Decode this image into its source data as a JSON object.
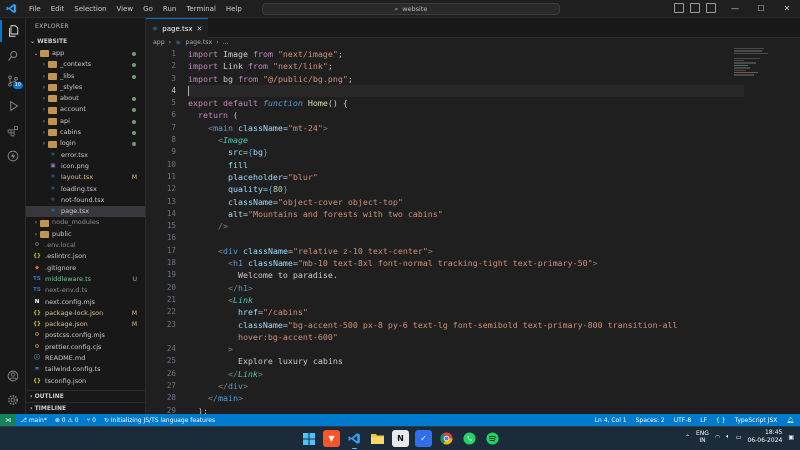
{
  "titlebar": {
    "menu": [
      "File",
      "Edit",
      "Selection",
      "View",
      "Go",
      "Run",
      "Terminal",
      "Help"
    ],
    "search_text": "website"
  },
  "sidebar": {
    "title": "EXPLORER",
    "root": "WEBSITE",
    "items": [
      {
        "label": "app",
        "type": "folder",
        "open": true,
        "indent": 0,
        "status": "dot",
        "cls": "lbl"
      },
      {
        "label": "_contexts",
        "type": "folder",
        "indent": 1,
        "status": "dot",
        "cls": "lbl"
      },
      {
        "label": "_libs",
        "type": "folder",
        "indent": 1,
        "status": "dot",
        "cls": "lbl"
      },
      {
        "label": "_styles",
        "type": "folder",
        "indent": 1,
        "status": "",
        "cls": "lbl"
      },
      {
        "label": "about",
        "type": "folder",
        "indent": 1,
        "status": "dot",
        "cls": "lbl"
      },
      {
        "label": "account",
        "type": "folder",
        "indent": 1,
        "status": "dot",
        "cls": "lbl"
      },
      {
        "label": "api",
        "type": "folder",
        "indent": 1,
        "status": "dot",
        "cls": "lbl"
      },
      {
        "label": "cabins",
        "type": "folder",
        "indent": 1,
        "status": "dot",
        "cls": "lbl"
      },
      {
        "label": "login",
        "type": "folder",
        "indent": 1,
        "status": "dot",
        "cls": "lbl"
      },
      {
        "label": "error.tsx",
        "type": "tsx",
        "indent": 2,
        "status": "",
        "cls": "lbl"
      },
      {
        "label": "icon.png",
        "type": "img",
        "indent": 2,
        "status": "",
        "cls": "lbl"
      },
      {
        "label": "layout.tsx",
        "type": "tsx",
        "indent": 2,
        "status": "M",
        "cls": "lbl mod"
      },
      {
        "label": "loading.tsx",
        "type": "tsx",
        "indent": 2,
        "status": "",
        "cls": "lbl"
      },
      {
        "label": "not-found.tsx",
        "type": "tsx",
        "indent": 2,
        "status": "",
        "cls": "lbl"
      },
      {
        "label": "page.tsx",
        "type": "tsx",
        "indent": 2,
        "status": "",
        "cls": "lbl",
        "selected": true
      },
      {
        "label": "node_modules",
        "type": "folder",
        "indent": 0,
        "status": "",
        "cls": "lbl dim"
      },
      {
        "label": "public",
        "type": "folder",
        "indent": 0,
        "status": "",
        "cls": "lbl"
      },
      {
        "label": ".env.local",
        "type": "env",
        "indent": 0,
        "status": "",
        "cls": "lbl dim"
      },
      {
        "label": ".eslintrc.json",
        "type": "json",
        "indent": 0,
        "status": "",
        "cls": "lbl"
      },
      {
        "label": ".gitignore",
        "type": "git",
        "indent": 0,
        "status": "",
        "cls": "lbl"
      },
      {
        "label": "middleware.ts",
        "type": "ts",
        "indent": 0,
        "status": "U",
        "cls": "lbl untr"
      },
      {
        "label": "next-env.d.ts",
        "type": "ts",
        "indent": 0,
        "status": "",
        "cls": "lbl dim"
      },
      {
        "label": "next.config.mjs",
        "type": "next",
        "indent": 0,
        "status": "",
        "cls": "lbl"
      },
      {
        "label": "package-lock.json",
        "type": "json",
        "indent": 0,
        "status": "M",
        "cls": "lbl mod"
      },
      {
        "label": "package.json",
        "type": "json",
        "indent": 0,
        "status": "M",
        "cls": "lbl mod"
      },
      {
        "label": "postcss.config.mjs",
        "type": "js",
        "indent": 0,
        "status": "",
        "cls": "lbl"
      },
      {
        "label": "prettier.config.cjs",
        "type": "js",
        "indent": 0,
        "status": "",
        "cls": "lbl"
      },
      {
        "label": "README.md",
        "type": "md",
        "indent": 0,
        "status": "",
        "cls": "lbl"
      },
      {
        "label": "tailwind.config.ts",
        "type": "tw",
        "indent": 0,
        "status": "",
        "cls": "lbl"
      },
      {
        "label": "tsconfig.json",
        "type": "json",
        "indent": 0,
        "status": "",
        "cls": "lbl"
      }
    ],
    "outline": "OUTLINE",
    "timeline": "TIMELINE"
  },
  "editor": {
    "tab": "page.tsx",
    "breadcrumb": [
      "app",
      "page.tsx",
      "..."
    ],
    "lines": [
      [
        [
          "kw",
          "import"
        ],
        [
          "txt",
          " Image "
        ],
        [
          "kw",
          "from"
        ],
        [
          "txt",
          " "
        ],
        [
          "str",
          "\"next/image\""
        ],
        [
          "txt",
          ";"
        ]
      ],
      [
        [
          "kw",
          "import"
        ],
        [
          "txt",
          " Link "
        ],
        [
          "kw",
          "from"
        ],
        [
          "txt",
          " "
        ],
        [
          "str",
          "\"next/link\""
        ],
        [
          "txt",
          ";"
        ]
      ],
      [
        [
          "kw",
          "import"
        ],
        [
          "txt",
          " bg "
        ],
        [
          "kw",
          "from"
        ],
        [
          "txt",
          " "
        ],
        [
          "str",
          "\"@/public/bg.png\""
        ],
        [
          "txt",
          ";"
        ]
      ],
      [],
      [
        [
          "kw",
          "export"
        ],
        [
          "txt",
          " "
        ],
        [
          "kw",
          "default"
        ],
        [
          "txt",
          " "
        ],
        [
          "kw2 it",
          "function"
        ],
        [
          "txt",
          " "
        ],
        [
          "fn",
          "Home"
        ],
        [
          "txt",
          "() {"
        ]
      ],
      [
        [
          "txt",
          "  "
        ],
        [
          "kw",
          "return"
        ],
        [
          "txt",
          " ("
        ]
      ],
      [
        [
          "txt",
          "    "
        ],
        [
          "punc",
          "<"
        ],
        [
          "tag",
          "main"
        ],
        [
          "txt",
          " "
        ],
        [
          "attr",
          "className"
        ],
        [
          "txt",
          "="
        ],
        [
          "str",
          "\"mt-24\""
        ],
        [
          "punc",
          ">"
        ]
      ],
      [
        [
          "txt",
          "      "
        ],
        [
          "punc",
          "<"
        ],
        [
          "comp it",
          "Image"
        ]
      ],
      [
        [
          "txt",
          "        "
        ],
        [
          "attr",
          "src"
        ],
        [
          "txt",
          "="
        ],
        [
          "brace",
          "{"
        ],
        [
          "var",
          "bg"
        ],
        [
          "brace",
          "}"
        ]
      ],
      [
        [
          "txt",
          "        "
        ],
        [
          "attr",
          "fill"
        ]
      ],
      [
        [
          "txt",
          "        "
        ],
        [
          "attr",
          "placeholder"
        ],
        [
          "txt",
          "="
        ],
        [
          "str",
          "\"blur\""
        ]
      ],
      [
        [
          "txt",
          "        "
        ],
        [
          "attr",
          "quality"
        ],
        [
          "txt",
          "="
        ],
        [
          "brace",
          "{"
        ],
        [
          "num",
          "80"
        ],
        [
          "brace",
          "}"
        ]
      ],
      [
        [
          "txt",
          "        "
        ],
        [
          "attr",
          "className"
        ],
        [
          "txt",
          "="
        ],
        [
          "str",
          "\"object-cover object-top\""
        ]
      ],
      [
        [
          "txt",
          "        "
        ],
        [
          "attr",
          "alt"
        ],
        [
          "txt",
          "="
        ],
        [
          "str",
          "\"Mountains and forests with two cabins\""
        ]
      ],
      [
        [
          "txt",
          "      "
        ],
        [
          "punc",
          "/>"
        ]
      ],
      [],
      [
        [
          "txt",
          "      "
        ],
        [
          "punc",
          "<"
        ],
        [
          "tag",
          "div"
        ],
        [
          "txt",
          " "
        ],
        [
          "attr",
          "className"
        ],
        [
          "txt",
          "="
        ],
        [
          "str",
          "\"relative z-10 text-center\""
        ],
        [
          "punc",
          ">"
        ]
      ],
      [
        [
          "txt",
          "        "
        ],
        [
          "punc",
          "<"
        ],
        [
          "tag",
          "h1"
        ],
        [
          "txt",
          " "
        ],
        [
          "attr",
          "className"
        ],
        [
          "txt",
          "="
        ],
        [
          "str",
          "\"mb-10 text-8xl font-normal tracking-tight text-primary-50\""
        ],
        [
          "punc",
          ">"
        ]
      ],
      [
        [
          "txt",
          "          Welcome to paradise."
        ]
      ],
      [
        [
          "txt",
          "        "
        ],
        [
          "punc",
          "</"
        ],
        [
          "tag",
          "h1"
        ],
        [
          "punc",
          ">"
        ]
      ],
      [
        [
          "txt",
          "        "
        ],
        [
          "punc",
          "<"
        ],
        [
          "comp it",
          "Link"
        ]
      ],
      [
        [
          "txt",
          "          "
        ],
        [
          "attr",
          "href"
        ],
        [
          "txt",
          "="
        ],
        [
          "str",
          "\"/cabins\""
        ]
      ],
      [
        [
          "txt",
          "          "
        ],
        [
          "attr",
          "className"
        ],
        [
          "txt",
          "="
        ],
        [
          "str",
          "\"bg-accent-500 px-8 py-6 text-lg font-semibold text-primary-800 transition-all"
        ]
      ],
      [
        [
          "str",
          "          hover:bg-accent-600\""
        ]
      ],
      [
        [
          "txt",
          "        "
        ],
        [
          "punc",
          ">"
        ]
      ],
      [
        [
          "txt",
          "          Explore luxury cabins"
        ]
      ],
      [
        [
          "txt",
          "        "
        ],
        [
          "punc",
          "</"
        ],
        [
          "comp it",
          "Link"
        ],
        [
          "punc",
          ">"
        ]
      ],
      [
        [
          "txt",
          "      "
        ],
        [
          "punc",
          "</"
        ],
        [
          "tag",
          "div"
        ],
        [
          "punc",
          ">"
        ]
      ],
      [
        [
          "txt",
          "    "
        ],
        [
          "punc",
          "</"
        ],
        [
          "tag",
          "main"
        ],
        [
          "punc",
          ">"
        ]
      ],
      [
        [
          "txt",
          "  );"
        ]
      ]
    ],
    "line_numbers": [
      "1",
      "2",
      "3",
      "4",
      "5",
      "6",
      "7",
      "8",
      "9",
      "10",
      "11",
      "12",
      "13",
      "14",
      "15",
      "16",
      "17",
      "18",
      "19",
      "20",
      "21",
      "22",
      "23",
      "",
      "24",
      "25",
      "26",
      "27",
      "28",
      "29"
    ],
    "current_line_index": 3
  },
  "statusbar": {
    "branch": "main*",
    "problems": "0 ⚠ 0",
    "ports": "0",
    "message": "Initializing JS/TS language features",
    "position": "Ln 4, Col 1",
    "spaces": "Spaces: 2",
    "encoding": "UTF-8",
    "eol": "LF",
    "braces": "{ }",
    "language": "TypeScript JSX"
  },
  "taskbar": {
    "lang_top": "ENG",
    "lang_bottom": "IN",
    "time": "18:45",
    "date": "06-06-2024"
  }
}
